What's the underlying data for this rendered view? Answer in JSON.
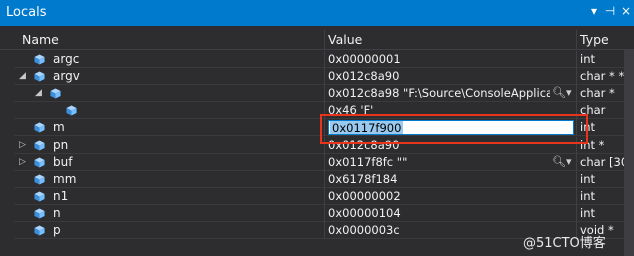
{
  "window": {
    "title": "Locals",
    "dropdown_icon": "▾",
    "pin_icon": "⊣",
    "close_icon": "×"
  },
  "columns": {
    "name": "Name",
    "value": "Value",
    "type": "Type"
  },
  "rows": [
    {
      "name": "argc",
      "value": "0x00000001",
      "type": "int",
      "indent": 0,
      "expander": ""
    },
    {
      "name": "argv",
      "value": "0x012c8a90",
      "type": "char * *",
      "indent": 0,
      "expander": "◢"
    },
    {
      "name": "",
      "value": "0x012c8a98 \"F:\\Source\\ConsoleApplicatio",
      "type": "char *",
      "indent": 1,
      "expander": "◢",
      "search": true
    },
    {
      "name": "",
      "value": "0x46 'F'",
      "type": "char",
      "indent": 2,
      "expander": ""
    },
    {
      "name": "m",
      "value": "",
      "type": "int",
      "indent": 0,
      "expander": ""
    },
    {
      "name": "pn",
      "value": "0x012c8a90",
      "type": "int *",
      "indent": 0,
      "expander": "▷"
    },
    {
      "name": "buf",
      "value": "0x0117f8fc \"\"",
      "type": "char [30]",
      "indent": 0,
      "expander": "▷",
      "search": true
    },
    {
      "name": "mm",
      "value": "0x6178f184",
      "type": "int",
      "indent": 0,
      "expander": ""
    },
    {
      "name": "n1",
      "value": "0x00000002",
      "type": "int",
      "indent": 0,
      "expander": ""
    },
    {
      "name": "n",
      "value": "0x00000104",
      "type": "int",
      "indent": 0,
      "expander": ""
    },
    {
      "name": "p",
      "value": "0x0000003c",
      "type": "void *",
      "indent": 0,
      "expander": ""
    }
  ],
  "edit": {
    "value": "0x0117f900"
  },
  "watermark": "@51CTO博客",
  "colors": {
    "titlebar": "#007acc",
    "background": "#2d2d30",
    "cube": "#75beff",
    "highlight": "#e8341c"
  }
}
